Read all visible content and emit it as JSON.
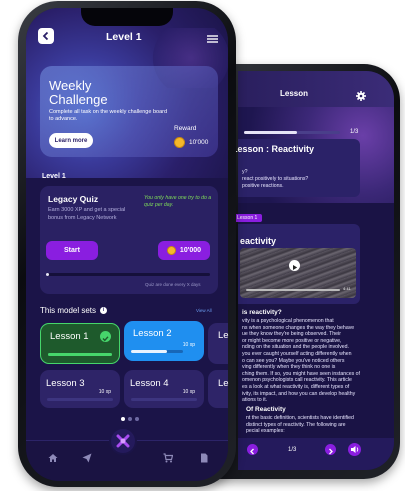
{
  "back_phone": {
    "title": "Lesson",
    "progress": "1/3",
    "progress_fraction": 0.55,
    "lesson_title": "Lesson : Reactivity",
    "intro_lines": [
      "y?",
      "react positively to situations?",
      "positive reactions."
    ],
    "badge": "Lesson 1",
    "video_title": "eactivity",
    "video_time": "4:41",
    "section1_title": "is reactivity?",
    "section1_lines": [
      "vity is a psychological phenomenon that",
      "ns when someone changes the way they behave",
      "ue they know they're being observed. Their",
      "or might become more positive or negative,",
      "nding on the situation and the people involved.",
      "you ever caught yourself acting differently when",
      "o can see you? Maybe you've noticed others",
      "ving differently when they think no one is",
      "ching them. If so, you might have seen instances of",
      "omenon psychologists call reactivity. This article",
      "es a look at what reactivity is, different types of",
      "ivity, its impact, and how you can develop healthy",
      "ations to it."
    ],
    "section2_title": "Of Reactivity",
    "section2_lines": [
      "nt the basic definition, scientists have identified",
      "distinct types of reactivity. The following are",
      "pecial examples:"
    ],
    "page_indicator": "1/3",
    "prev_icon": "chevron-left-icon",
    "next_icon": "chevron-right-icon",
    "sound_icon": "speaker-icon"
  },
  "header": {
    "title": "Level 1",
    "back_icon": "chevron-left-icon",
    "menu_icon": "hamburger-menu-icon"
  },
  "challenge": {
    "title_line1": "Weekly",
    "title_line2": "Challenge",
    "description": "Complete all task on the weekly challenge board to advance.",
    "button": "Learn more",
    "reward_label": "Reward",
    "reward_value": "10'000"
  },
  "level": {
    "label": "Level 1",
    "quiz_title": "Legacy Quiz",
    "quiz_subtitle": "Earn 3000 XP and get a special bonus from Legacy Network",
    "quiz_note": "You only have one try to do a quiz per day.",
    "start_label": "Start",
    "reward_value": "10'000",
    "progress_fraction": 0.02,
    "footer_note": "Quiz are done every X days"
  },
  "model_sets": {
    "title": "This model sets",
    "view_all": "View All",
    "lessons": [
      {
        "name": "Lesson 1",
        "xp": "",
        "progress": 1.0,
        "state": "completed"
      },
      {
        "name": "Lesson 2",
        "xp": "10 xp",
        "progress": 0.7,
        "state": "active"
      },
      {
        "name": "Le",
        "xp": "",
        "progress": 0,
        "state": "locked"
      },
      {
        "name": "Lesson 3",
        "xp": "10 xp",
        "progress": 0,
        "state": "locked"
      },
      {
        "name": "Lesson 4",
        "xp": "10 xp",
        "progress": 0,
        "state": "locked"
      },
      {
        "name": "Le",
        "xp": "",
        "progress": 0,
        "state": "locked"
      }
    ],
    "pager_dots": 3,
    "pager_active": 0
  },
  "tabbar": {
    "items": [
      "home-icon",
      "send-icon",
      "center-logo-icon",
      "cart-icon",
      "document-icon"
    ]
  },
  "colors": {
    "background": "#1b1448",
    "card": "#2a2163",
    "accent_purple": "#8a1ee0",
    "lesson_active": "#1f8ff0",
    "lesson_completed": "#1e5a2c",
    "check_green": "#46d66b",
    "quiz_note_green": "#7fdc5a"
  }
}
